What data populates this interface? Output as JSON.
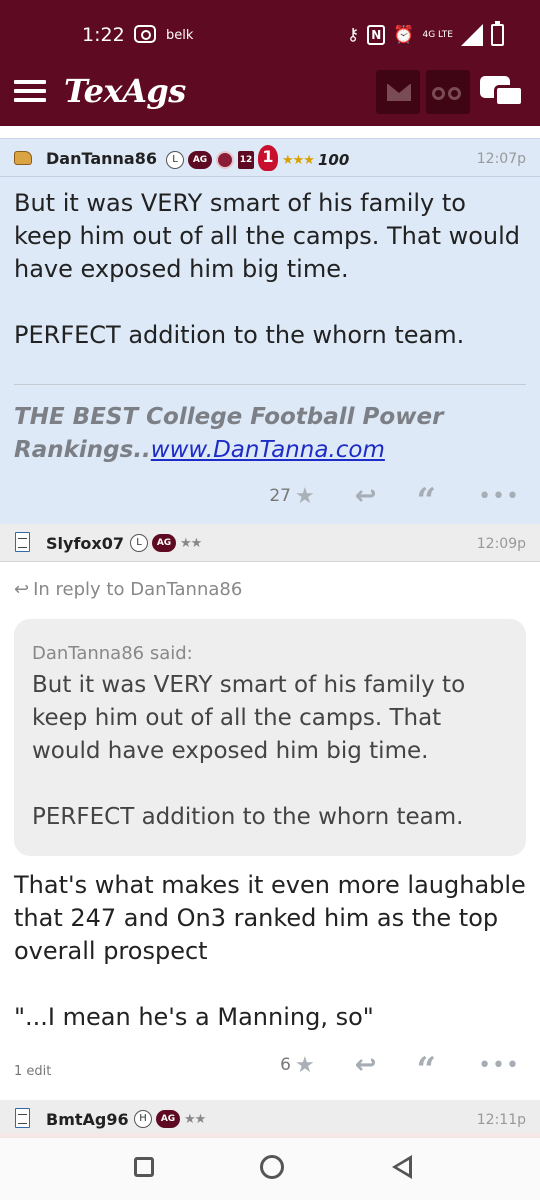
{
  "status_bar": {
    "time": "1:22",
    "carrier_label": "belk",
    "network_label": "4G LTE",
    "icons": [
      "cast-icon",
      "key-icon",
      "nfc-icon",
      "alarm-icon",
      "signal-icon",
      "battery-charging-icon"
    ]
  },
  "app_bar": {
    "logo": "TexAgs",
    "icons": [
      "menu-icon",
      "mail-icon",
      "binoculars-icon",
      "chat-icon"
    ]
  },
  "posts": [
    {
      "user": "DanTanna86",
      "badges": [
        "L",
        "AG",
        "12",
        "1",
        "★★★",
        "100"
      ],
      "time": "12:07p",
      "body": [
        "But it was VERY smart of his family to keep him out of all the camps. That would have exposed him big time.",
        "PERFECT addition to the whorn team."
      ],
      "signature_text": "THE BEST College Football Power Rankings..",
      "signature_link": "www.DanTanna.com",
      "star_count": "27"
    },
    {
      "user": "Slyfox07",
      "badges": [
        "L",
        "AG",
        "★★"
      ],
      "time": "12:09p",
      "reply_to": "In reply to DanTanna86",
      "quote_author": "DanTanna86 said:",
      "quote_body": [
        "But it was VERY smart of his family to keep him out of all the camps. That would have exposed him big time.",
        "PERFECT addition to the whorn team."
      ],
      "body": [
        "That's what makes it even more laughable that 247 and On3 ranked him as the top overall prospect",
        "\"...I mean he's a Manning, so\""
      ],
      "edits": "1 edit",
      "star_count": "6"
    },
    {
      "user": "BmtAg96",
      "badges": [
        "H",
        "AG",
        "★★"
      ],
      "time": "12:11p"
    }
  ],
  "colors": {
    "brand": "#5d0a22",
    "highlight_post_bg": "#dde9f7",
    "link": "#1d2cc7"
  }
}
